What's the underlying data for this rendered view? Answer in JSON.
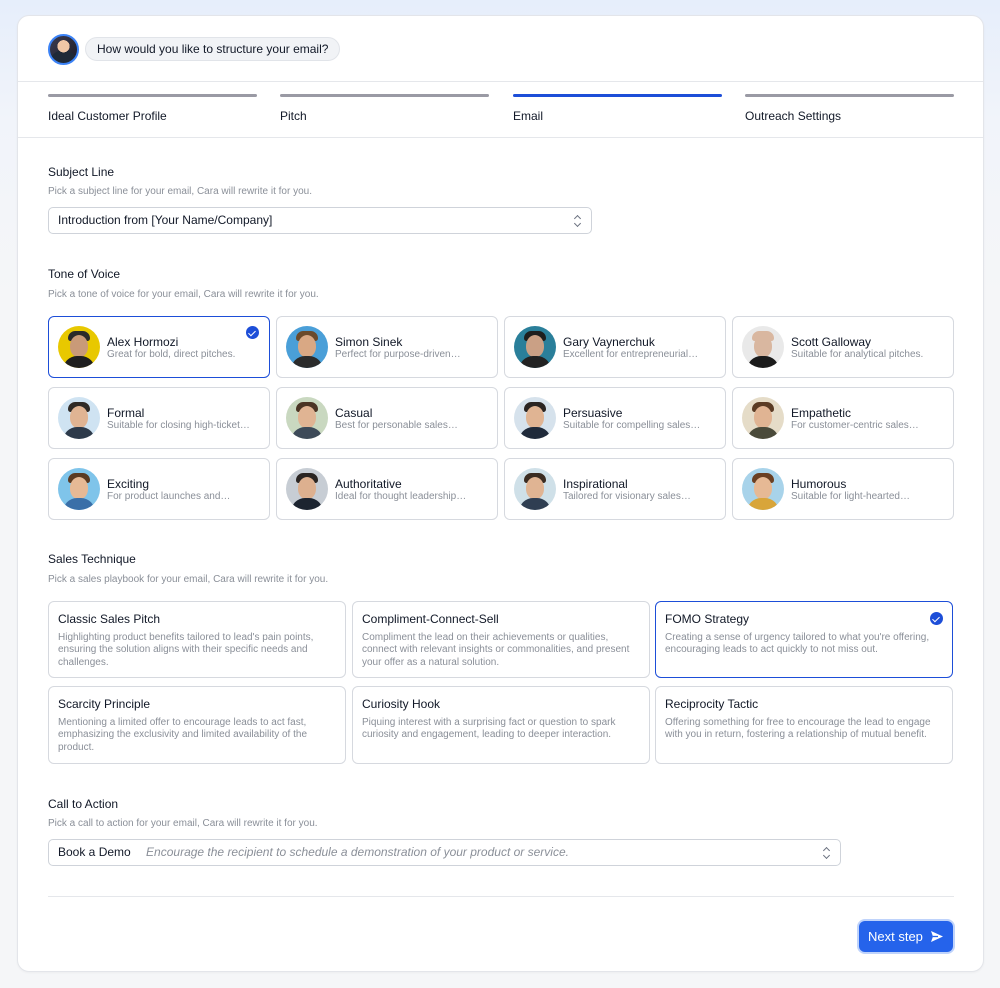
{
  "header": {
    "prompt": "How would you like to structure your email?"
  },
  "steps": [
    {
      "label": "Ideal Customer Profile",
      "active": false
    },
    {
      "label": "Pitch",
      "active": false
    },
    {
      "label": "Email",
      "active": true
    },
    {
      "label": "Outreach Settings",
      "active": false
    }
  ],
  "subject": {
    "title": "Subject Line",
    "subtitle": "Pick a subject line for your email, Cara will rewrite it for you.",
    "value": "Introduction from [Your Name/Company]"
  },
  "tone": {
    "title": "Tone of Voice",
    "subtitle": "Pick a tone of voice for your email, Cara will rewrite it for you.",
    "items": [
      {
        "name": "Alex Hormozi",
        "desc": "Great for bold, direct pitches.",
        "selected": true
      },
      {
        "name": "Simon Sinek",
        "desc": "Perfect for purpose-driven…"
      },
      {
        "name": "Gary Vaynerchuk",
        "desc": "Excellent for entrepreneurial…"
      },
      {
        "name": "Scott Galloway",
        "desc": "Suitable for analytical pitches."
      },
      {
        "name": "Formal",
        "desc": "Suitable for closing high-ticket…"
      },
      {
        "name": "Casual",
        "desc": "Best for personable sales…"
      },
      {
        "name": "Persuasive",
        "desc": "Suitable for compelling sales…"
      },
      {
        "name": "Empathetic",
        "desc": "For customer-centric sales…"
      },
      {
        "name": "Exciting",
        "desc": "For product launches and…"
      },
      {
        "name": "Authoritative",
        "desc": "Ideal for thought leadership…"
      },
      {
        "name": "Inspirational",
        "desc": "Tailored for visionary sales…"
      },
      {
        "name": "Humorous",
        "desc": "Suitable for light-hearted…"
      }
    ]
  },
  "technique": {
    "title": "Sales Technique",
    "subtitle": "Pick a sales playbook for your email, Cara will rewrite it for you.",
    "items": [
      {
        "title": "Classic Sales Pitch",
        "desc": "Highlighting product benefits tailored to lead's pain points, ensuring the solution aligns with their specific needs and challenges."
      },
      {
        "title": "Compliment-Connect-Sell",
        "desc": "Compliment the lead on their achievements or qualities, connect with relevant insights or commonalities, and present your offer as a natural solution."
      },
      {
        "title": "FOMO Strategy",
        "desc": "Creating a sense of urgency tailored to what you're offering, encouraging leads to act quickly to not miss out.",
        "selected": true
      },
      {
        "title": "Scarcity Principle",
        "desc": "Mentioning a limited offer to encourage leads to act fast, emphasizing the exclusivity and limited availability of the product."
      },
      {
        "title": "Curiosity Hook",
        "desc": "Piquing interest with a surprising fact or question to spark curiosity and engagement, leading to deeper interaction."
      },
      {
        "title": "Reciprocity Tactic",
        "desc": "Offering something for free to encourage the lead to engage with you in return, fostering a relationship of mutual benefit."
      }
    ]
  },
  "cta": {
    "title": "Call to Action",
    "subtitle": "Pick a call to action for your email, Cara will rewrite it for you.",
    "value": "Book a Demo",
    "hint": "Encourage the recipient to schedule a demonstration of your product or service."
  },
  "footer": {
    "next_label": "Next step"
  },
  "colors": {
    "accent": "#1d4ed8",
    "button": "#2563eb"
  }
}
